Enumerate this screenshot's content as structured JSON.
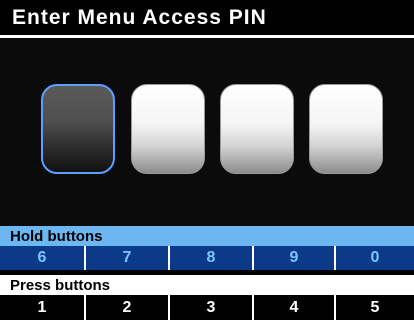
{
  "title": "Enter Menu Access PIN",
  "pin": {
    "length": 4,
    "active_index": 0
  },
  "hold": {
    "label": "Hold buttons",
    "keys": [
      "6",
      "7",
      "8",
      "9",
      "0"
    ]
  },
  "press": {
    "label": "Press buttons",
    "keys": [
      "1",
      "2",
      "3",
      "4",
      "5"
    ]
  },
  "colors": {
    "accent_blue": "#6cb6f2",
    "active_border": "#5aa0ff",
    "hold_row_bg": "#0b3a88",
    "hold_key_text": "#7fc3ff"
  }
}
